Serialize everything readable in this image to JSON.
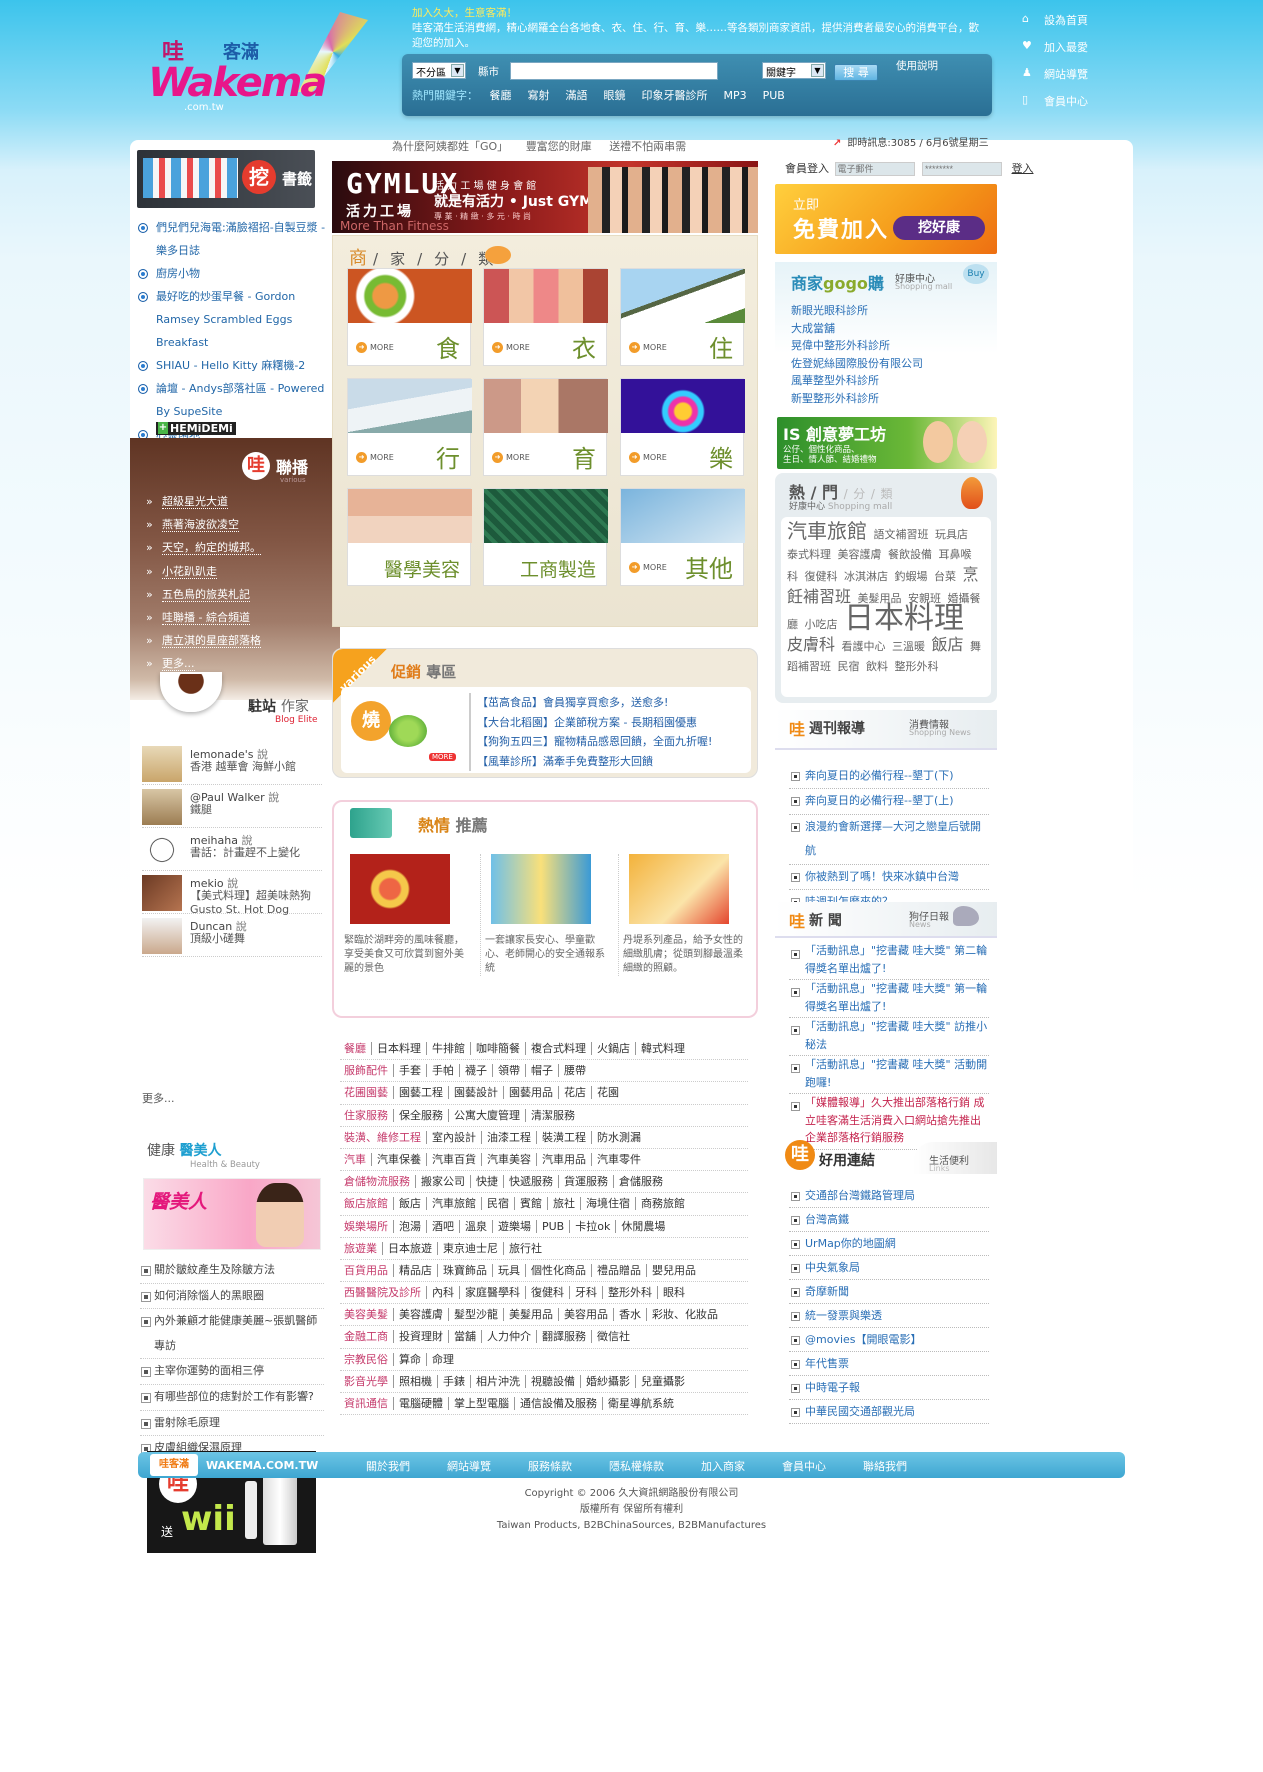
{
  "header": {
    "logo": {
      "wa": "哇",
      "keman": "客滿",
      "brand": "Wakema",
      "domain": ".com.tw"
    },
    "intro_line1": "加入久大，生意客滿！",
    "intro_line2": "哇客滿生活消費網，精心網羅全台各地食、衣、住、行、育、樂……等各類別商家資訊，提供消費者最安心的消費平台，歡迎您的加入。",
    "search": {
      "region": "不分區",
      "city_label": "縣市",
      "field": "關鍵字",
      "button": "搜 尋",
      "help": "使用說明",
      "hot_label": "熱門關鍵字：",
      "hot": [
        "餐廳",
        "寫射",
        "滿語",
        "眼鏡",
        "印象牙醫診所",
        "MP3",
        "PUB"
      ]
    },
    "toplinks": [
      {
        "icon": "home-icon",
        "glyph": "⌂",
        "label": "設為首頁"
      },
      {
        "icon": "heart-icon",
        "glyph": "♥",
        "label": "加入最愛"
      },
      {
        "icon": "person-icon",
        "glyph": "♟",
        "label": "網站導覽"
      },
      {
        "icon": "member-icon",
        "glyph": "▯",
        "label": "會員中心"
      }
    ]
  },
  "left": {
    "bookmark_title": "書籤",
    "bookmark_logo": "挖",
    "bookmarks": [
      "們兒們兒海電:滿臉褶招-自製豆漿 - 樂多日誌",
      "廚房小物",
      "最好吃的炒蛋早餐 - Gordon Ramsey Scrambled Eggs Breakfast",
      "SHIAU - Hello Kitty 麻糬機-2",
      "論壇 - Andys部落社區 - Powered By SupeSite",
      "心靈園地"
    ],
    "hemidemi": "HEMiDEMi",
    "union_wa": "哇",
    "union_title": "聯播",
    "union_sub": "various",
    "union": [
      "超級星光大道",
      "燕著海波欲凌空",
      "天空，約定的城邦。",
      "小花趴趴走",
      "五色鳥的旅英札記",
      "哇聯播 - 綜合頻道",
      "唐立淇的星座部落格",
      "更多..."
    ],
    "writer_title": "駐站",
    "writer_title2": "作家",
    "writer_sub": "Blog Elite",
    "writers": [
      {
        "name": "lemonade's",
        "says": "說",
        "text": "香港 越華會 海鮮小館"
      },
      {
        "name": "@Paul Walker",
        "says": "說",
        "text": "鐵腿"
      },
      {
        "name": "meihaha",
        "says": "說",
        "text": "書話：計畫趕不上變化"
      },
      {
        "name": "mekio",
        "says": "說",
        "text": "【美式料理】超美味熱狗 Gusto St. Hot Dog"
      },
      {
        "name": "Duncan",
        "says": "說",
        "text": "頂級小磋舞"
      }
    ],
    "writers_more": "更多...",
    "health_title": "健康",
    "health_title2": "醫美人",
    "health_sub": "Health & Beauty",
    "health_banner": "醫美人",
    "health": [
      "關於皺紋產生及除皺方法",
      "如何消除惱人的黑眼圈",
      "內外兼顧才能健康美麗~張凱醫師專訪",
      "主宰你運勢的面相三停",
      "有哪些部位的痣對於工作有影響?",
      "雷射除毛原理",
      "皮膚組織保濕原理"
    ],
    "wii": {
      "wa": "哇",
      "send": "送",
      "wii": "wii"
    }
  },
  "middle": {
    "teasers": [
      "為什麼阿姨都姓「GO」",
      "豐富您的財庫",
      "送禮不怕兩串需"
    ],
    "gymlux": {
      "logo": "GYMLUX",
      "cn": "活力工場",
      "line1": "活 力 工 場 健 身 會 館",
      "line2": "就是有活力 • Just GYMLUX",
      "line3": "專 業 · 精 緻 · 多 元 · 時 尚",
      "motto": "More Than Fitness"
    },
    "cat_head": [
      "商",
      "家",
      "分",
      "類"
    ],
    "more": "MORE",
    "categories": [
      "食",
      "衣",
      "住",
      "行",
      "育",
      "樂",
      "醫學美容",
      "工商製造",
      "其他"
    ],
    "promo": {
      "ribbon": "various",
      "title1": "促銷",
      "title2": "專區",
      "hot": "燒",
      "badge": "MORE",
      "items": [
        "【茁高食品】會員獨享買愈多，送愈多!",
        "【大台北稻園】企業節稅方案 - 長期稻園優惠",
        "【狗狗五四三】寵物精品感恩回饋，全面九折喔!",
        "【風華診所】滿牽手免費整形大回饋"
      ]
    },
    "rec": {
      "title1": "熱情",
      "title2": "推薦",
      "items": [
        "緊臨於湖畔旁的風味餐廳，享受美食又可欣賞到窗外美麗的景色",
        "一套讓家長安心、學童歡心、老師開心的安全通報系統",
        "丹堤系列產品，給予女性的細緻肌膚；從頭到腳最溫柔細緻的照顧。"
      ]
    },
    "links": [
      [
        "餐廳",
        "日本料理",
        "牛排館",
        "咖啡簡餐",
        "複合式料理",
        "火鍋店",
        "韓式料理"
      ],
      [
        "服飾配件",
        "手套",
        "手帕",
        "襪子",
        "領帶",
        "帽子",
        "腰帶"
      ],
      [
        "花圃園藝",
        "園藝工程",
        "園藝設計",
        "園藝用品",
        "花店",
        "花園"
      ],
      [
        "住家服務",
        "保全服務",
        "公寓大廈管理",
        "清潔服務"
      ],
      [
        "裝潢、維修工程",
        "室內設計",
        "油漆工程",
        "裝潢工程",
        "防水測漏"
      ],
      [
        "汽車",
        "汽車保養",
        "汽車百貨",
        "汽車美容",
        "汽車用品",
        "汽車零件"
      ],
      [
        "倉儲物流服務",
        "搬家公司",
        "快捷",
        "快遞服務",
        "貨運服務",
        "倉儲服務"
      ],
      [
        "飯店旅館",
        "飯店",
        "汽車旅館",
        "民宿",
        "賓館",
        "旅社",
        "海境住宿",
        "商務旅館"
      ],
      [
        "娛樂場所",
        "泡湯",
        "酒吧",
        "溫泉",
        "遊樂場",
        "PUB",
        "卡拉ok",
        "休閒農場"
      ],
      [
        "旅遊業",
        "日本旅遊",
        "東京迪士尼",
        "旅行社"
      ],
      [
        "百貨用品",
        "精品店",
        "珠寶飾品",
        "玩具",
        "個性化商品",
        "禮品贈品",
        "嬰兒用品"
      ],
      [
        "西醫醫院及診所",
        "內科",
        "家庭醫學科",
        "復健科",
        "牙科",
        "整形外科",
        "眼科"
      ],
      [
        "美容美髮",
        "美容護膚",
        "髮型沙龍",
        "美髮用品",
        "美容用品",
        "香水",
        "彩妝、化妝品"
      ],
      [
        "金融工商",
        "投資理財",
        "當舖",
        "人力仲介",
        "翻譯服務",
        "徵信社"
      ],
      [
        "宗教民俗",
        "算命",
        "命理"
      ],
      [
        "影音光學",
        "照相機",
        "手錶",
        "相片沖洗",
        "視聽設備",
        "婚紗攝影",
        "兒童攝影"
      ],
      [
        "資訊通信",
        "電腦硬體",
        "掌上型電腦",
        "通信設備及服務",
        "衛星導航系統"
      ]
    ]
  },
  "right": {
    "instant": "即時訊息:3085 / 6月6號星期三",
    "login_label": "會員登入",
    "email_ph": "電子郵件",
    "pw_ph": "********",
    "login_btn": "登入",
    "join": {
      "a": "立即",
      "b": "免費加入",
      "c": "挖好康"
    },
    "gogo": {
      "title1": "商家",
      "title2": "gogo",
      "title3": "購",
      "sub": "好康中心",
      "sub2": "Shopping mall",
      "buy": "Buy",
      "items": [
        "新眼光眼科診所",
        "大成當舖",
        "晃偉中整形外科診所",
        "佐登妮絲國際股份有限公司",
        "風華整型外科診所",
        "新聖整形外科診所"
      ]
    },
    "is": {
      "title": "IS 創意夢工坊",
      "line1": "公仔、個性化商品、",
      "line2": "生日、情人節、結婚禮物"
    },
    "hotcat": {
      "title1": "熱",
      "title2": "門",
      "title3": "分",
      "title4": "類",
      "sub": "好康中心",
      "sub2": "Shopping mall",
      "cloud": [
        [
          "汽車旅館",
          "l1"
        ],
        [
          "語文補習班",
          ""
        ],
        [
          "玩具店",
          ""
        ],
        [
          "泰式料理",
          ""
        ],
        [
          "美容護膚",
          ""
        ],
        [
          "餐飲設備",
          ""
        ],
        [
          "耳鼻喉科",
          ""
        ],
        [
          "復健科",
          ""
        ],
        [
          "冰淇淋店",
          ""
        ],
        [
          "釣蝦場",
          ""
        ],
        [
          "台菜",
          ""
        ],
        [
          "烹飪補習班",
          "l3"
        ],
        [
          "美髮用品",
          ""
        ],
        [
          "安親班",
          ""
        ],
        [
          "婚攝餐廳",
          ""
        ],
        [
          "小吃店",
          ""
        ],
        [
          "日本料理",
          "l2"
        ],
        [
          "皮膚科",
          "l3"
        ],
        [
          "看護中心",
          ""
        ],
        [
          "三溫暖",
          ""
        ],
        [
          "飯店",
          "l3"
        ],
        [
          "舞蹈補習班",
          ""
        ],
        [
          "民宿",
          ""
        ],
        [
          "飲料",
          ""
        ],
        [
          "整形外科",
          ""
        ]
      ]
    },
    "week": {
      "wa": "哇",
      "title": "週刊報導",
      "sub": "消費情報",
      "sub2": "Shopping News",
      "items": [
        "奔向夏日的必備行程--墾丁(下)",
        "奔向夏日的必備行程--墾丁(上)",
        "浪漫約會新選擇—大河之戀皇后號開航",
        "你被熱到了嗎！快來冰鎮中台灣",
        "哇週刊怎麼來的？"
      ]
    },
    "news": {
      "wa": "哇",
      "title": "新 聞",
      "sub": "狗仔日報",
      "sub2": "News",
      "items": [
        {
          "t": "「活動訊息」\"挖書藏 哇大獎\" 第二輪得獎名單出爐了!",
          "r": false
        },
        {
          "t": "「活動訊息」\"挖書藏 哇大獎\" 第一輪得獎名單出爐了!",
          "r": false
        },
        {
          "t": "「活動訊息」\"挖書藏 哇大獎\" 訪推小秘法",
          "r": false
        },
        {
          "t": "「活動訊息」\"挖書藏 哇大獎\" 活動開跑囉!",
          "r": false
        },
        {
          "t": "「媒體報導」久大推出部落格行銷 成立哇客滿生活消費入口網站搶先推出企業部落格行銷服務",
          "r": true
        }
      ]
    },
    "links": {
      "wa": "哇",
      "title": "好用連結",
      "sub": "生活便利",
      "sub2": "Links",
      "items": [
        "交通部台灣鐵路管理局",
        "台灣高鐵",
        "UrMap你的地圖網",
        "中央氣象局",
        "奇摩新聞",
        "統一發票與樂透",
        "@movies【開眼電影】",
        "年代售票",
        "中時電子報",
        "中華民國交通部觀光局"
      ]
    }
  },
  "footer": {
    "logo": "哇客滿",
    "domain": "WAKEMA.COM.TW",
    "nav": [
      "關於我們",
      "網站導覽",
      "服務條款",
      "隱私權條款",
      "加入商家",
      "會員中心",
      "聯絡我們"
    ],
    "copy1": "Copyright © 2006   久大資訊網路股份有限公司",
    "copy2": "版權所有 保留所有權利",
    "copy3": "Taiwan Products, B2BChinaSources, B2BManufactures"
  },
  "colors": {
    "accent": "#1e9fd0",
    "orange": "#f07a12",
    "brown": "#835745",
    "link": "#2a6fb6"
  }
}
